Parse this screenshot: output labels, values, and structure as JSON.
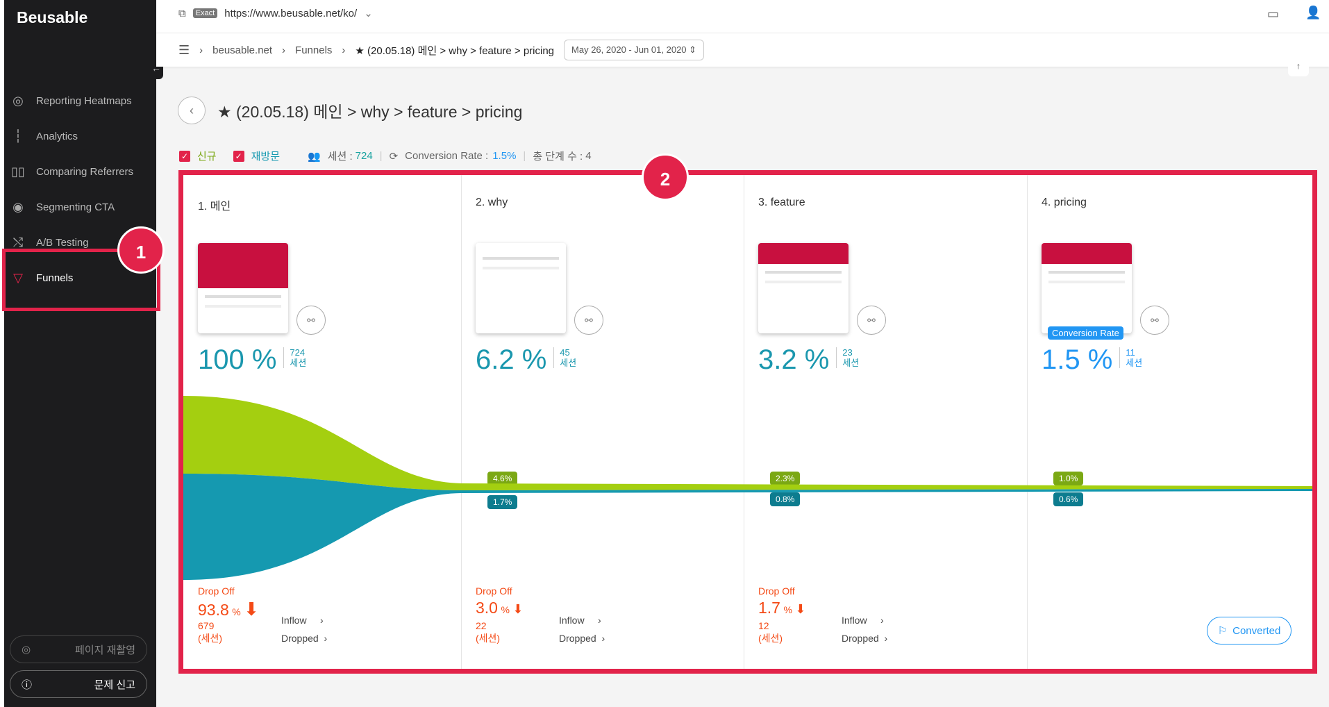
{
  "sidebar": {
    "logo": "Beusable",
    "items": [
      {
        "label": "Reporting Heatmaps",
        "icon": "target-icon"
      },
      {
        "label": "Analytics",
        "icon": "bar-chart-icon"
      },
      {
        "label": "Comparing Referrers",
        "icon": "columns-icon"
      },
      {
        "label": "Segmenting CTA",
        "icon": "fingerprint-icon"
      },
      {
        "label": "A/B Testing",
        "icon": "shuffle-icon"
      },
      {
        "label": "Funnels",
        "icon": "funnel-icon",
        "active": true
      }
    ],
    "recapture": "페이지 재촬영",
    "report": "문제 신고"
  },
  "annotations": {
    "badge1": "1",
    "badge2": "2",
    "color": "#e2234a"
  },
  "topbar": {
    "match": "Exact",
    "url": "https://www.beusable.net/ko/"
  },
  "breadcrumb": {
    "items": [
      "beusable.net",
      "Funnels",
      "★ (20.05.18) 메인 > why > feature > pricing"
    ],
    "date_range": "May 26, 2020 - Jun 01, 2020"
  },
  "page": {
    "title": "★ (20.05.18) 메인 > why > feature > pricing"
  },
  "filters": {
    "new": "신규",
    "returning": "재방문",
    "sessions_label": "세션 :",
    "sessions": "724",
    "cr_label": "Conversion Rate :",
    "cr": "1.5%",
    "steps_label": "총 단계 수 :",
    "steps": "4"
  },
  "steps": [
    {
      "name": "1.  메인",
      "pct": "100 %",
      "count": "724",
      "unit": "세션",
      "new_pct": "42.3%",
      "ret_pct": "57.7%",
      "drop_label": "Drop Off",
      "drop_pct": "93.8",
      "drop_count": "679",
      "drop_unit": "(세션)"
    },
    {
      "name": "2.  why",
      "pct": "6.2 %",
      "count": "45",
      "unit": "세션",
      "new_pct": "4.6%",
      "ret_pct": "1.7%",
      "drop_label": "Drop Off",
      "drop_pct": "3.0",
      "drop_count": "22",
      "drop_unit": "(세션)"
    },
    {
      "name": "3.  feature",
      "pct": "3.2 %",
      "count": "23",
      "unit": "세션",
      "new_pct": "2.3%",
      "ret_pct": "0.8%",
      "drop_label": "Drop Off",
      "drop_pct": "1.7",
      "drop_count": "12",
      "drop_unit": "(세션)"
    },
    {
      "name": "4.  pricing",
      "pct": "1.5 %",
      "count": "11",
      "unit": "세션",
      "new_pct": "1.0%",
      "ret_pct": "0.6%",
      "badge": "Conversion Rate"
    }
  ],
  "links": {
    "inflow": "Inflow",
    "dropped": "Dropped",
    "converted": "Converted",
    "pct_sign": "%"
  },
  "colors": {
    "new": "#a4cf10",
    "returning": "#1599b0",
    "drop": "#f44a16",
    "accent": "#2196f3"
  }
}
